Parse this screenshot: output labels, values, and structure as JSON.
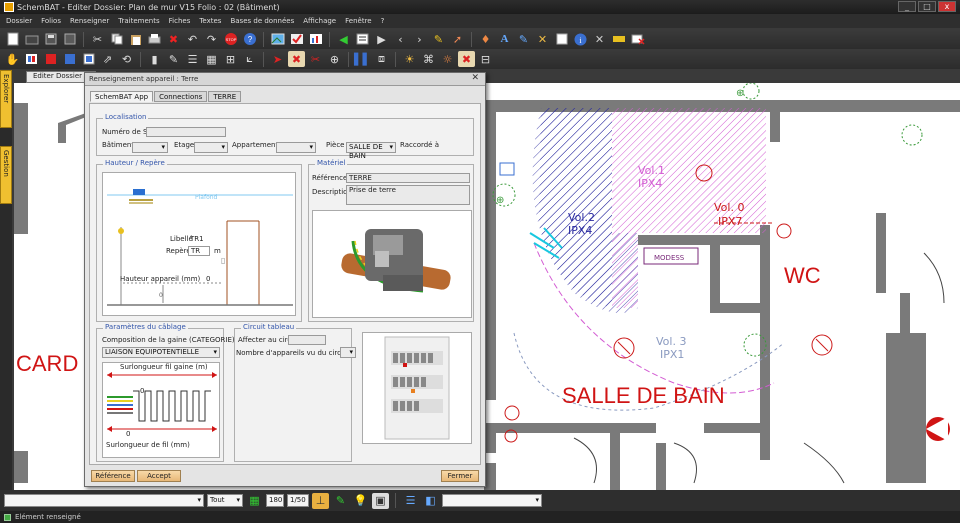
{
  "window": {
    "title": "SchemBAT - Editer Dossier: Plan de mur V15 Folio : 02 (Bâtiment)",
    "buttons": [
      "_",
      "□",
      "x"
    ]
  },
  "menu": [
    "Dossier",
    "Folios",
    "Renseigner",
    "Traitements",
    "Fiches",
    "Textes",
    "Bases de données",
    "Affichage",
    "Fenêtre",
    "?"
  ],
  "toolbar1": [
    "new-icon",
    "open-icon",
    "save-icon",
    "save-all-icon",
    "cut-icon",
    "copy-icon",
    "paste-icon",
    "print-icon",
    "delete-icon",
    "undo-icon",
    "redo-icon",
    "stop-icon",
    "help-icon",
    "image-icon",
    "check-icon",
    "chart-icon",
    "first-icon",
    "list-icon",
    "last-icon",
    "prev-icon",
    "next-icon",
    "tool-icon",
    "arrow-icon",
    "symbol-icon",
    "text-icon",
    "edit-icon",
    "tools-icon",
    "frame-icon",
    "info-icon",
    "cross-icon",
    "ruler-icon",
    "erase-icon"
  ],
  "toolbar2": [
    "hand-icon",
    "layers-icon",
    "book-icon",
    "bookmark-icon",
    "module-icon",
    "pointer-icon",
    "rotate-icon",
    "cursor-icon",
    "draw-icon",
    "list-view-icon",
    "grid-icon",
    "table-icon",
    "measure-icon",
    "bar-icon",
    "mark-icon",
    "select-icon",
    "wire-icon",
    "flag-icon",
    "clear-icon",
    "split-icon"
  ],
  "left_dock": [
    "Explorer",
    "Gestion"
  ],
  "doc_tab": "Editer Dossier",
  "dialog": {
    "title": "Renseignement appareil : Terre",
    "tabs": [
      "SchemBAT App",
      "Connections",
      "TERRE"
    ],
    "localisation": {
      "legend": "Localisation",
      "numero_label": "Numéro de Sélection",
      "batiment_label": "Bâtiment",
      "etage_label": "Etage",
      "appartement_label": "Appartement",
      "piece_label": "Pièce",
      "piece_value": "SALLE DE BAIN",
      "raccorde_label": "Raccordé à"
    },
    "hauteur": {
      "legend": "Hauteur / Repère",
      "ligne_label": "Libellé",
      "ligne_value": "TR1",
      "repere_label": "Repère",
      "repere_value": "TR",
      "unit": "m",
      "hauteur_label": "Hauteur appareil (mm)",
      "hauteur_value": "0",
      "top_label": "Plafond"
    },
    "materiel": {
      "legend": "Matériel",
      "reference_label": "Référence",
      "reference_value": "TERRE",
      "description_label": "Description",
      "description_value": "Prise de terre"
    },
    "parametres": {
      "legend": "Paramètres du câblage",
      "composition_label": "Composition de la gaine (CATEGORIE)",
      "composition_value": "LIAISON EQUIPOTENTIELLE",
      "surlongueur_label": "Surlongueur fil gaine (m)",
      "surlongueur2_label": "Surlongueur de fil (mm)",
      "value_a": "0",
      "value_b": "0"
    },
    "circuit": {
      "legend": "Circuit tableau",
      "affecter_label": "Affecter au circuit",
      "nombre_label": "Nombre d'appareils vu du circuit"
    },
    "footer": {
      "reference_btn": "Référence",
      "accept_btn": "Accept",
      "close_btn": "Fermer"
    }
  },
  "plan": {
    "labels": {
      "card": "CARD",
      "salle_de_bain": "SALLE DE BAIN",
      "wc": "WC",
      "vol1": "Vol.1",
      "ipx4a": "IPX4",
      "vol2": "Vol.2",
      "ipx4b": "IPX4",
      "vol0": "Vol. 0",
      "ipx7": "IPX7",
      "vol3": "Vol. 3",
      "ipx1": "IPX1",
      "mini": "MODESS"
    },
    "colors": {
      "wall": "#7a7a7a",
      "vol1": "#d35cd3",
      "vol2": "#2a2aa0",
      "vol0": "#cc1a1a",
      "vol3": "#8a9ac0",
      "red": "#d01414",
      "cyan": "#18c8e0"
    }
  },
  "bottombar": {
    "combo1": "",
    "combo2": "Tout",
    "zoom1": "180",
    "zoom2": "1/50",
    "combo3": ""
  },
  "status": {
    "text": "Elément renseigné"
  }
}
